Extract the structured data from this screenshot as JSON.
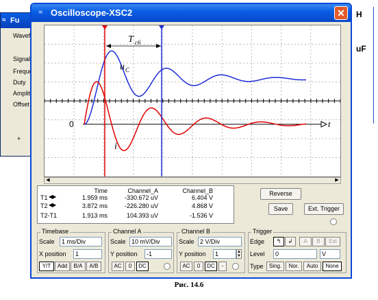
{
  "left_window": {
    "title": "Fu",
    "labels": [
      "Wavef",
      "Signal",
      "Freque",
      "Duty",
      "Amplit",
      "Offset",
      "+"
    ]
  },
  "right_window": {
    "labels": [
      "H",
      "uF"
    ]
  },
  "window": {
    "title": "Oscilloscope-XSC2",
    "close": "✕"
  },
  "screen": {
    "t_period_label": "T",
    "t_period_sub": "c6",
    "uc_label": "u",
    "uc_sub": "C",
    "i_label": "i",
    "zero_label": "0",
    "t_axis_label": "t",
    "colors": {
      "channel_a": "#e00000",
      "channel_b": "#1e2bd6",
      "cursor1": "#e00000",
      "cursor2": "#1e2bd6"
    }
  },
  "readout": {
    "headers": {
      "time": "Time",
      "a": "Channel_A",
      "b": "Channel_B"
    },
    "rows": [
      {
        "label": "T1",
        "time": "1.959 ms",
        "a": "-330.672 uV",
        "b": "6.404 V"
      },
      {
        "label": "T2",
        "time": "3.872 ms",
        "a": "-226.280 uV",
        "b": "4.868 V"
      },
      {
        "label": "T2-T1",
        "time": "1.913 ms",
        "a": "104.393 uV",
        "b": "-1.536 V"
      }
    ]
  },
  "buttons": {
    "reverse": "Reverse",
    "save": "Save",
    "ext_trigger": "Ext. Trigger"
  },
  "timebase": {
    "title": "Timebase",
    "scale_label": "Scale",
    "scale": "1 ms/Div",
    "xpos_label": "X position",
    "xpos": "1",
    "modes": [
      "Y/T",
      "Add",
      "B/A",
      "A/B"
    ]
  },
  "channel_a": {
    "title": "Channel A",
    "scale_label": "Scale",
    "scale": "10 mV/Div",
    "ypos_label": "Y position",
    "ypos": "-1",
    "modes": [
      "AC",
      "0",
      "DC"
    ]
  },
  "channel_b": {
    "title": "Channel B",
    "scale_label": "Scale",
    "scale": "2  V/Div",
    "ypos_label": "Y position",
    "ypos": "1",
    "modes": [
      "AC",
      "0",
      "DC",
      "-"
    ]
  },
  "trigger": {
    "title": "Trigger",
    "edge_label": "Edge",
    "level_label": "Level",
    "level": "0",
    "level_unit": "V",
    "type_label": "Type",
    "sources": [
      "A",
      "B",
      "Ext"
    ],
    "types": [
      "Sing.",
      "Nor.",
      "Auto",
      "None"
    ]
  },
  "caption": "Рис. 14.6"
}
